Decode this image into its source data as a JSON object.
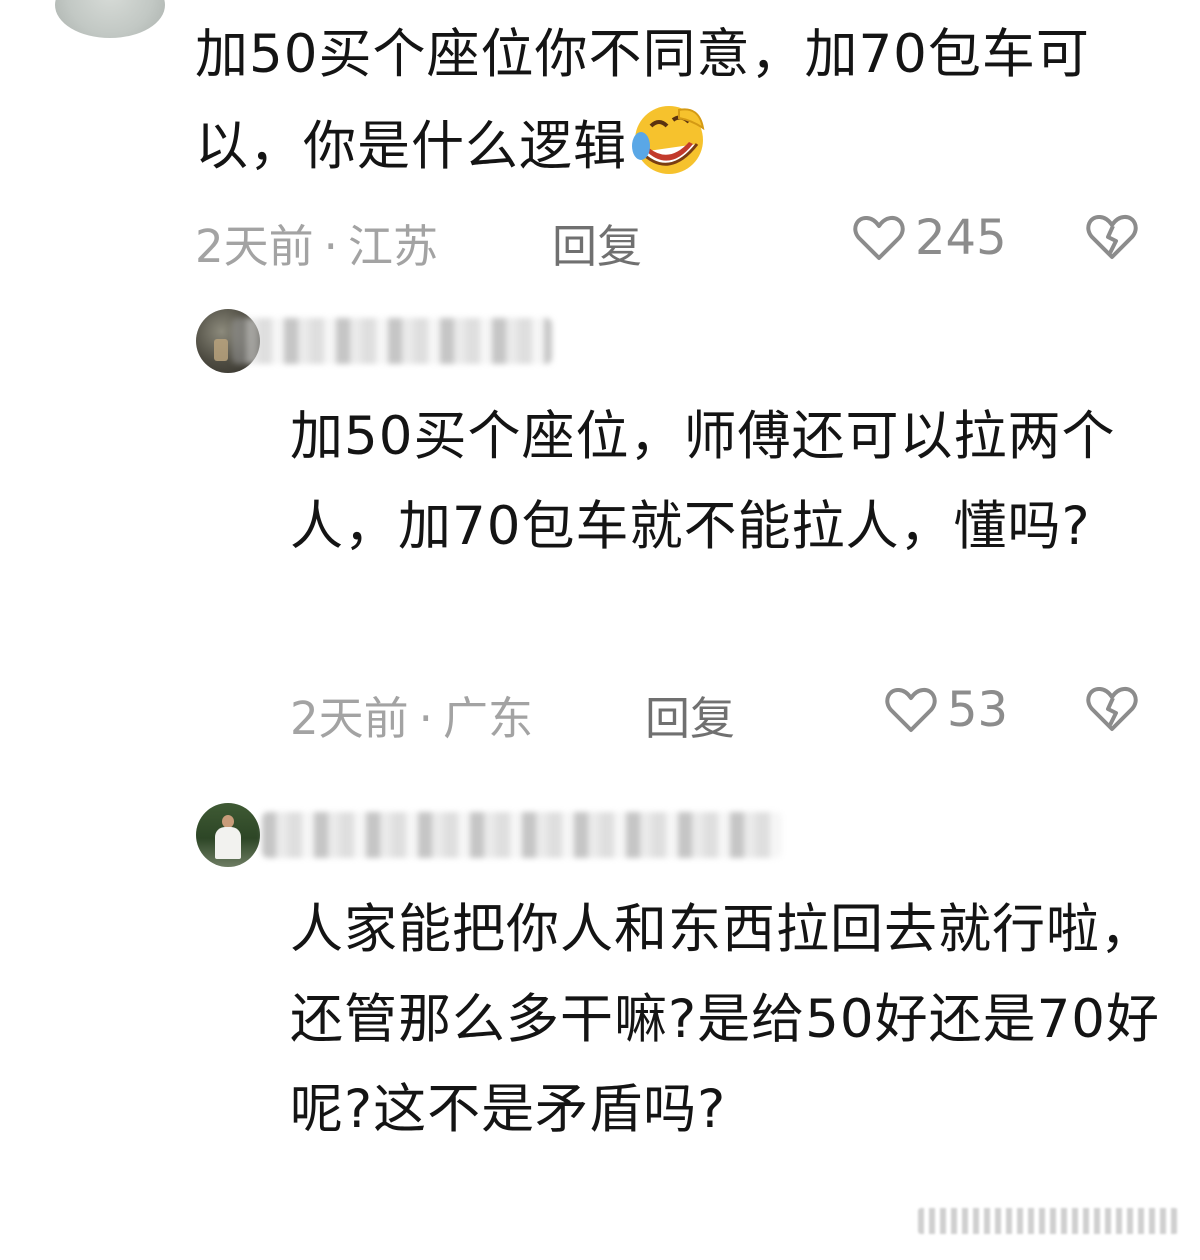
{
  "comments": [
    {
      "text": "加50买个座位你不同意，加70包车可以，你是什么逻辑",
      "emoji": "rofl-emoji",
      "time": "2天前",
      "location": "江苏",
      "reply_label": "回复",
      "likes": "245"
    },
    {
      "text": "加50买个座位，师傅还可以拉两个人，加70包车就不能拉人，懂吗?",
      "time": "2天前",
      "location": "广东",
      "reply_label": "回复",
      "likes": "53"
    },
    {
      "text": "人家能把你人和东西拉回去就行啦，还管那么多干嘛?是给50好还是70好呢?这不是矛盾吗?"
    }
  ],
  "icons": {
    "like": "heart-outline-icon",
    "dislike": "broken-heart-icon"
  },
  "colors": {
    "meta_text": "#a3a3a3",
    "reply_text": "#707070",
    "body_text": "#141414"
  }
}
